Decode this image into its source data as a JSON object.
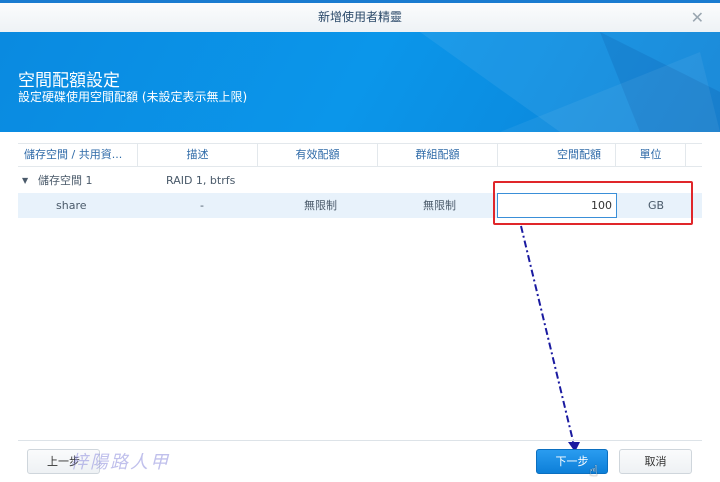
{
  "window": {
    "title": "新增使用者精靈"
  },
  "banner": {
    "title": "空間配額設定",
    "subtitle": "設定硬碟使用空間配額 (未設定表示無上限)"
  },
  "table": {
    "headers": [
      "儲存空間 / 共用資...",
      "描述",
      "有效配額",
      "群組配額",
      "空間配額",
      "單位"
    ],
    "group": {
      "name": "儲存空間 1",
      "description": "RAID 1, btrfs"
    },
    "rows": [
      {
        "name": "share",
        "description": "-",
        "effective": "無限制",
        "group_quota": "無限制",
        "quota": "100",
        "unit": "GB"
      }
    ]
  },
  "footer": {
    "back": "上一步",
    "next": "下一步",
    "cancel": "取消"
  },
  "watermark": "梓陽路人甲",
  "colors": {
    "accent": "#0b8fe3",
    "highlight": "#e0262a",
    "arrow": "#1a1aa0"
  }
}
